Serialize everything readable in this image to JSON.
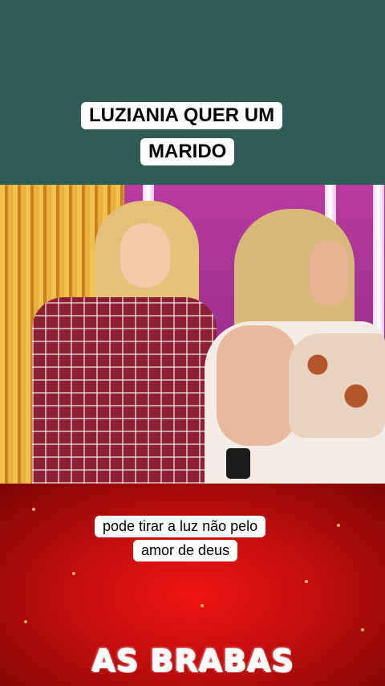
{
  "top_caption": {
    "line1": "LUZIANIA QUER UM",
    "line2": "MARIDO"
  },
  "subtitle": {
    "line1": "pode tirar a luz não pelo",
    "line2": "amor de deus"
  },
  "brand": {
    "name": "AS BRABAS"
  },
  "colors": {
    "top_panel": "#2f5c54",
    "bottom_panel": "#d10f0f",
    "caption_bg": "#ffffff"
  }
}
